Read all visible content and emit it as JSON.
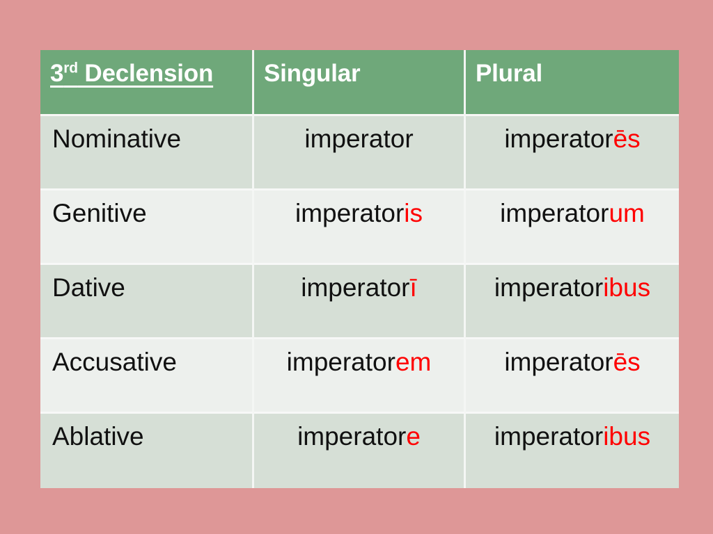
{
  "slide": {
    "background_color": "#de9797",
    "accent_header_color": "#6fa87a",
    "ending_highlight_color": "#ff0000",
    "row_odd_color": "#d6dfd6",
    "row_even_color": "#edf0ed"
  },
  "table": {
    "headers": {
      "case_label_main": "3",
      "case_label_sup": "rd",
      "case_label_rest": " Declension",
      "singular": "Singular",
      "plural": "Plural"
    },
    "rows": [
      {
        "case": "Nominative",
        "singular_stem": "imperator",
        "singular_ending": "",
        "plural_stem": "imperator",
        "plural_ending": "ēs"
      },
      {
        "case": "Genitive",
        "singular_stem": "imperator",
        "singular_ending": "is",
        "plural_stem": "imperator",
        "plural_ending": "um"
      },
      {
        "case": "Dative",
        "singular_stem": "imperator",
        "singular_ending": "ī",
        "plural_stem": "imperator",
        "plural_ending": "ibus"
      },
      {
        "case": "Accusative",
        "singular_stem": "imperator",
        "singular_ending": "em",
        "plural_stem": "imperator",
        "plural_ending": "ēs"
      },
      {
        "case": "Ablative",
        "singular_stem": "imperator",
        "singular_ending": "e",
        "plural_stem": "imperator",
        "plural_ending": "ibus"
      }
    ]
  }
}
